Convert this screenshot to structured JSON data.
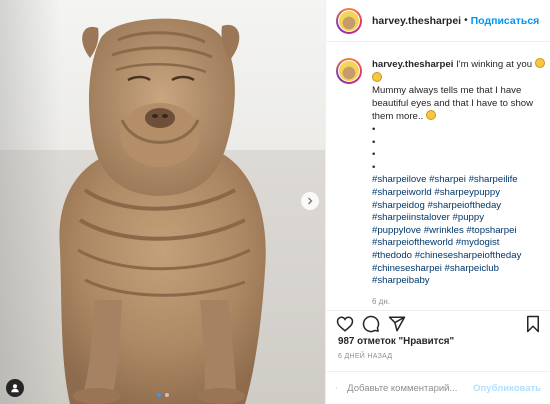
{
  "post": {
    "username": "harvey.thesharpei",
    "follow_label": "Подписаться",
    "separator": "•",
    "caption": {
      "first_line": "I'm winking at you",
      "body": "Mummy always tells me that I have beautiful eyes and that I have to show them more..",
      "bullets": [
        "•",
        "•",
        "•",
        "•"
      ],
      "hashtags": [
        "#sharpeilove",
        "#sharpei",
        "#sharpeilife",
        "#sharpeiworld",
        "#sharpeypuppy",
        "#sharpeidog",
        "#sharpeioftheday",
        "#sharpeiinstalover",
        "#puppy",
        "#puppylove",
        "#wrinkles",
        "#topsharpei",
        "#sharpeioftheworld",
        "#mydogist",
        "#thedodo",
        "#chinesesharpeioftheday",
        "#chinesesharpei",
        "#sharpeiclub",
        "#sharpeibaby"
      ],
      "age": "6 дн."
    },
    "likes": {
      "count": "987",
      "label": "отметок \"Нравится\""
    },
    "posted": "6 ДНЕЙ НАЗАД",
    "comment": {
      "placeholder": "Добавьте комментарий...",
      "publish_label": "Опубликовать"
    }
  },
  "media": {
    "slide_count": 2,
    "active_slide": 1
  },
  "icons": {
    "like": "heart-icon",
    "comment": "comment-icon",
    "share": "paper-plane-icon",
    "save": "bookmark-icon",
    "emoji": "smiley-icon",
    "next": "chevron-right-icon",
    "tag": "user-icon"
  },
  "colors": {
    "accent": "#0095f6",
    "hashtag": "#00376b",
    "muted": "#8e8e8e",
    "publish_disabled": "#b2dffc"
  }
}
